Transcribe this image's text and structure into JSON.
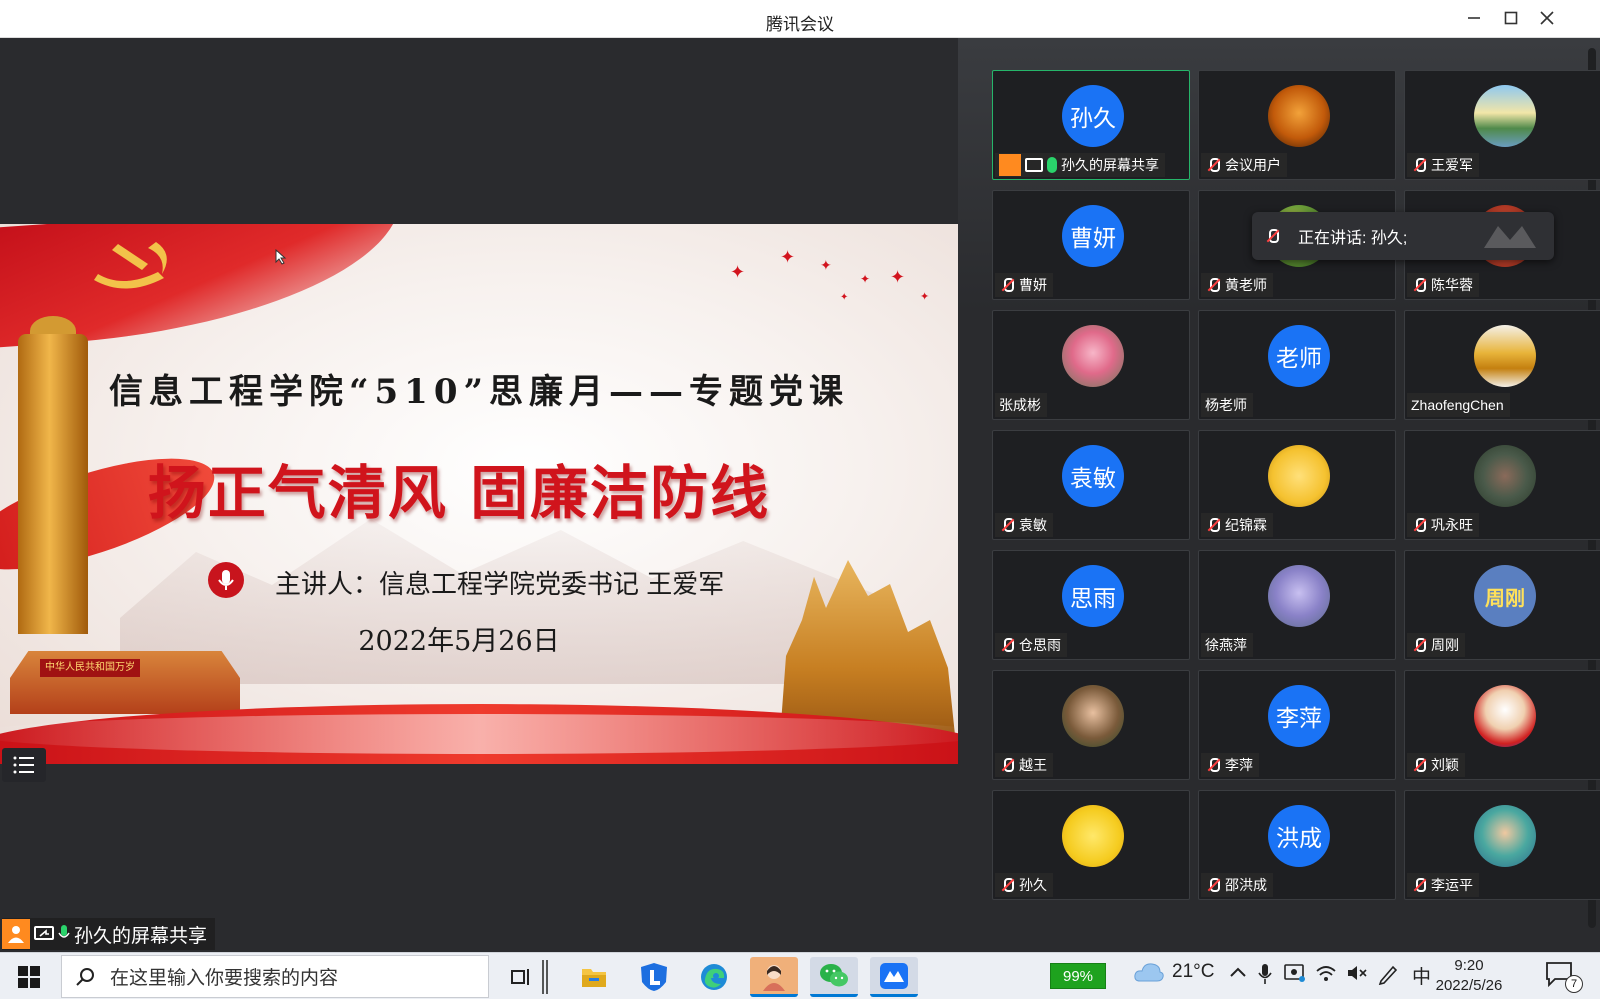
{
  "window": {
    "title": "腾讯会议"
  },
  "slide": {
    "subtitle": "信息工程学院“510”思廉月——专题党课",
    "headline": "扬正气清风  固廉洁防线",
    "speaker": "主讲人：信息工程学院党委书记  王爱军",
    "date": "2022年5月26日",
    "gate_sign": "中华人民共和国万岁"
  },
  "share": {
    "sharer_label": "孙久的屏幕共享"
  },
  "participants": [
    {
      "name": "孙久的屏幕共享",
      "avatar_text": "孙久",
      "avatar_type": "blue",
      "status": "sharer"
    },
    {
      "name": "会议用户",
      "avatar_text": "",
      "avatar_type": "photo-orange",
      "status": "muted"
    },
    {
      "name": "王爱军",
      "avatar_text": "",
      "avatar_type": "photo-landscape",
      "status": "muted"
    },
    {
      "name": "曹妍",
      "avatar_text": "曹妍",
      "avatar_type": "blue",
      "status": "muted"
    },
    {
      "name": "黄老师",
      "avatar_text": "",
      "avatar_type": "photo-flower",
      "status": "muted"
    },
    {
      "name": "陈华蓉",
      "avatar_text": "",
      "avatar_type": "photo-red",
      "status": "muted"
    },
    {
      "name": "张成彬",
      "avatar_text": "",
      "avatar_type": "photo-pink",
      "status": "none"
    },
    {
      "name": "杨老师",
      "avatar_text": "老师",
      "avatar_type": "blue",
      "status": "none"
    },
    {
      "name": "ZhaofengChen",
      "avatar_text": "",
      "avatar_type": "photo-gold",
      "status": "none"
    },
    {
      "name": "袁敏",
      "avatar_text": "袁敏",
      "avatar_type": "blue",
      "status": "muted"
    },
    {
      "name": "纪锦霖",
      "avatar_text": "",
      "avatar_type": "photo-yellow",
      "status": "muted"
    },
    {
      "name": "巩永旺",
      "avatar_text": "",
      "avatar_type": "photo-people",
      "status": "muted"
    },
    {
      "name": "仓思雨",
      "avatar_text": "思雨",
      "avatar_type": "blue",
      "status": "muted"
    },
    {
      "name": "徐燕萍",
      "avatar_text": "",
      "avatar_type": "photo-lavender",
      "status": "none"
    },
    {
      "name": "周刚",
      "avatar_text": "周刚",
      "avatar_type": "slate",
      "status": "muted"
    },
    {
      "name": "越王",
      "avatar_text": "",
      "avatar_type": "photo-child",
      "status": "muted"
    },
    {
      "name": "李萍",
      "avatar_text": "李萍",
      "avatar_type": "blue",
      "status": "muted"
    },
    {
      "name": "刘颖",
      "avatar_text": "",
      "avatar_type": "photo-mario",
      "status": "muted"
    },
    {
      "name": "孙久",
      "avatar_text": "",
      "avatar_type": "photo-cartoon",
      "status": "muted"
    },
    {
      "name": "邵洪成",
      "avatar_text": "洪成",
      "avatar_type": "blue",
      "status": "muted"
    },
    {
      "name": "李运平",
      "avatar_text": "",
      "avatar_type": "photo-shell",
      "status": "muted"
    }
  ],
  "speaking_popup": {
    "text": "正在讲话: 孙久;"
  },
  "taskbar": {
    "search_placeholder": "在这里输入你要搜索的内容",
    "battery": "99%",
    "temperature": "21°C",
    "ime": "中",
    "time": "9:20",
    "date": "2022/5/26",
    "notification_count": "7"
  },
  "colors": {
    "accent_blue": "#1a73f5",
    "speaking_green": "#26b56a",
    "slide_red": "#d0141c"
  }
}
